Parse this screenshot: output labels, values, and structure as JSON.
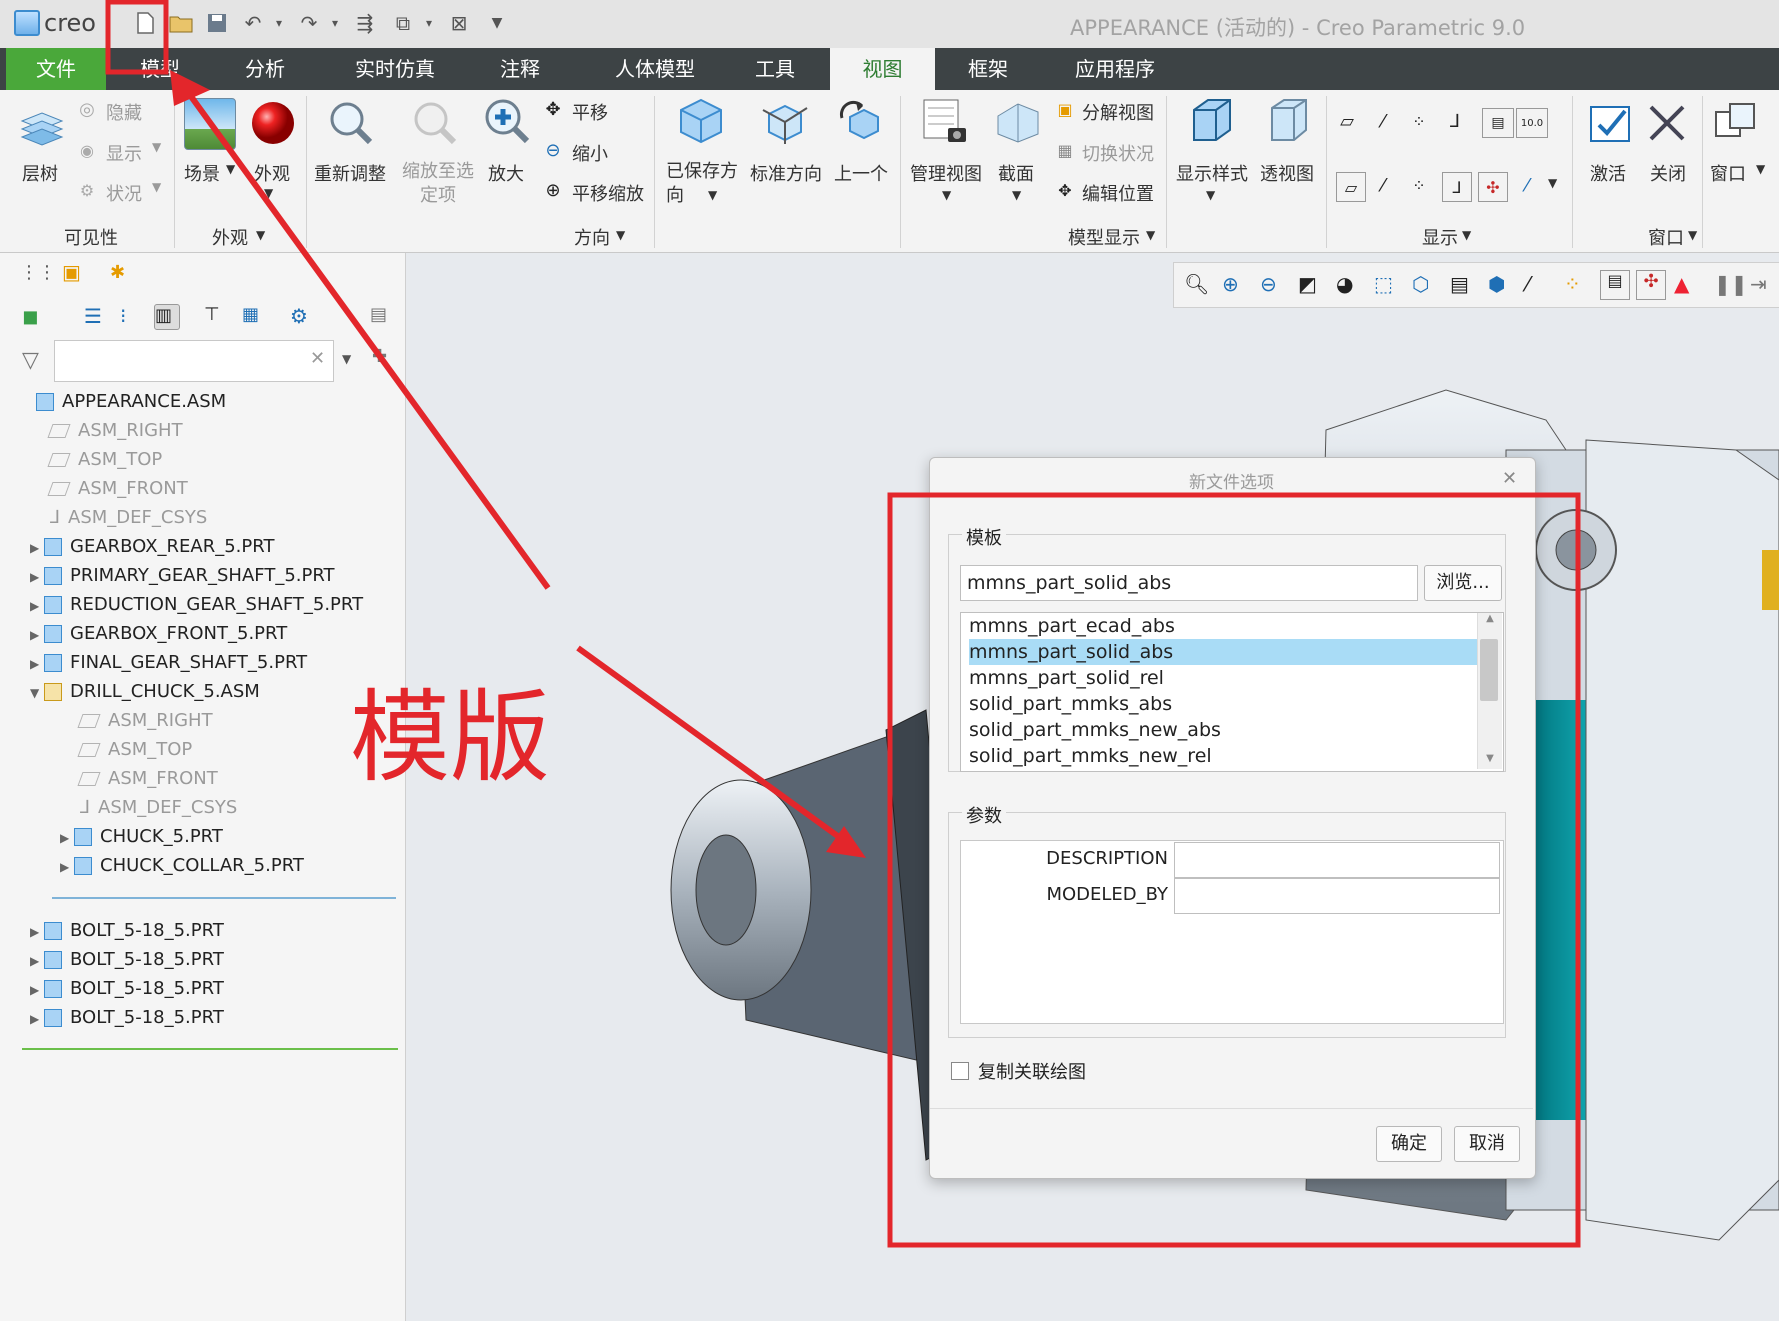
{
  "app": {
    "logo_text": "creo",
    "window_title": "APPEARANCE (活动的) - Creo Parametric 9.0"
  },
  "ribbon": {
    "tabs": [
      "文件",
      "模型",
      "分析",
      "实时仿真",
      "注释",
      "人体模型",
      "工具",
      "视图",
      "框架",
      "应用程序"
    ],
    "groups": {
      "visibility": {
        "label": "可见性",
        "layer_tree": "层树",
        "hide": "隐藏",
        "show": "显示",
        "status": "状况"
      },
      "appearance": {
        "label": "外观",
        "scene": "场景",
        "appearance": "外观"
      },
      "orientation": {
        "label": "方向",
        "refit": "重新调整",
        "zoom_to_selected": "缩放至选定项",
        "zoom_in": "放大",
        "pan": "平移",
        "zoom_out": "缩小",
        "pan_zoom": "平移缩放",
        "saved_orientations": "已保存方向",
        "standard_orientation": "标准方向",
        "previous": "上一个"
      },
      "model_display": {
        "label": "模型显示",
        "manage_views": "管理视图",
        "section": "截面",
        "exploded_view": "分解视图",
        "toggle_status": "切换状况",
        "edit_position": "编辑位置",
        "display_style": "显示样式",
        "perspective": "透视图"
      },
      "show": {
        "label": "显示"
      },
      "window": {
        "label": "窗口",
        "activate": "激活",
        "close": "关闭",
        "window": "窗口"
      }
    }
  },
  "tree": {
    "items": [
      {
        "label": "APPEARANCE.ASM",
        "type": "asm",
        "level": 0,
        "expand": "",
        "gray": false
      },
      {
        "label": "ASM_RIGHT",
        "type": "datum",
        "level": 1,
        "expand": "",
        "gray": true
      },
      {
        "label": "ASM_TOP",
        "type": "datum",
        "level": 1,
        "expand": "",
        "gray": true
      },
      {
        "label": "ASM_FRONT",
        "type": "datum",
        "level": 1,
        "expand": "",
        "gray": true
      },
      {
        "label": "ASM_DEF_CSYS",
        "type": "csys",
        "level": 1,
        "expand": "",
        "gray": true
      },
      {
        "label": "GEARBOX_REAR_5.PRT",
        "type": "part",
        "level": 1,
        "expand": "▶",
        "gray": false
      },
      {
        "label": "PRIMARY_GEAR_SHAFT_5.PRT",
        "type": "part",
        "level": 1,
        "expand": "▶",
        "gray": false
      },
      {
        "label": "REDUCTION_GEAR_SHAFT_5.PRT",
        "type": "part",
        "level": 1,
        "expand": "▶",
        "gray": false
      },
      {
        "label": "GEARBOX_FRONT_5.PRT",
        "type": "part",
        "level": 1,
        "expand": "▶",
        "gray": false
      },
      {
        "label": "FINAL_GEAR_SHAFT_5.PRT",
        "type": "part",
        "level": 1,
        "expand": "▶",
        "gray": false
      },
      {
        "label": "DRILL_CHUCK_5.ASM",
        "type": "asm",
        "level": 1,
        "expand": "▼",
        "gray": false
      },
      {
        "label": "ASM_RIGHT",
        "type": "datum",
        "level": 2,
        "expand": "",
        "gray": true
      },
      {
        "label": "ASM_TOP",
        "type": "datum",
        "level": 2,
        "expand": "",
        "gray": true
      },
      {
        "label": "ASM_FRONT",
        "type": "datum",
        "level": 2,
        "expand": "",
        "gray": true
      },
      {
        "label": "ASM_DEF_CSYS",
        "type": "csys",
        "level": 2,
        "expand": "",
        "gray": true
      },
      {
        "label": "CHUCK_5.PRT",
        "type": "part",
        "level": 2,
        "expand": "▶",
        "gray": false
      },
      {
        "label": "CHUCK_COLLAR_5.PRT",
        "type": "part",
        "level": 2,
        "expand": "▶",
        "gray": false
      },
      {
        "label": "BOLT_5-18_5.PRT",
        "type": "part",
        "level": 1,
        "expand": "▶",
        "gray": false
      },
      {
        "label": "BOLT_5-18_5.PRT",
        "type": "part",
        "level": 1,
        "expand": "▶",
        "gray": false
      },
      {
        "label": "BOLT_5-18_5.PRT",
        "type": "part",
        "level": 1,
        "expand": "▶",
        "gray": false
      },
      {
        "label": "BOLT_5-18_5.PRT",
        "type": "part",
        "level": 1,
        "expand": "▶",
        "gray": false
      }
    ]
  },
  "dialog": {
    "title": "新文件选项",
    "template_label": "模板",
    "template_value": "mmns_part_solid_abs",
    "browse_label": "浏览...",
    "templates": [
      "mmns_part_ecad_abs",
      "mmns_part_solid_abs",
      "mmns_part_solid_rel",
      "solid_part_mmks_abs",
      "solid_part_mmks_new_abs",
      "solid_part_mmks_new_rel"
    ],
    "selected_index": 1,
    "params_label": "参数",
    "params": [
      {
        "name": "DESCRIPTION",
        "value": ""
      },
      {
        "name": "MODELED_BY",
        "value": ""
      }
    ],
    "copy_drawing_label": "复制关联绘图",
    "copy_drawing_checked": false,
    "ok_label": "确定",
    "cancel_label": "取消"
  },
  "annotation": {
    "text": "模版",
    "color": "#e3262b"
  }
}
